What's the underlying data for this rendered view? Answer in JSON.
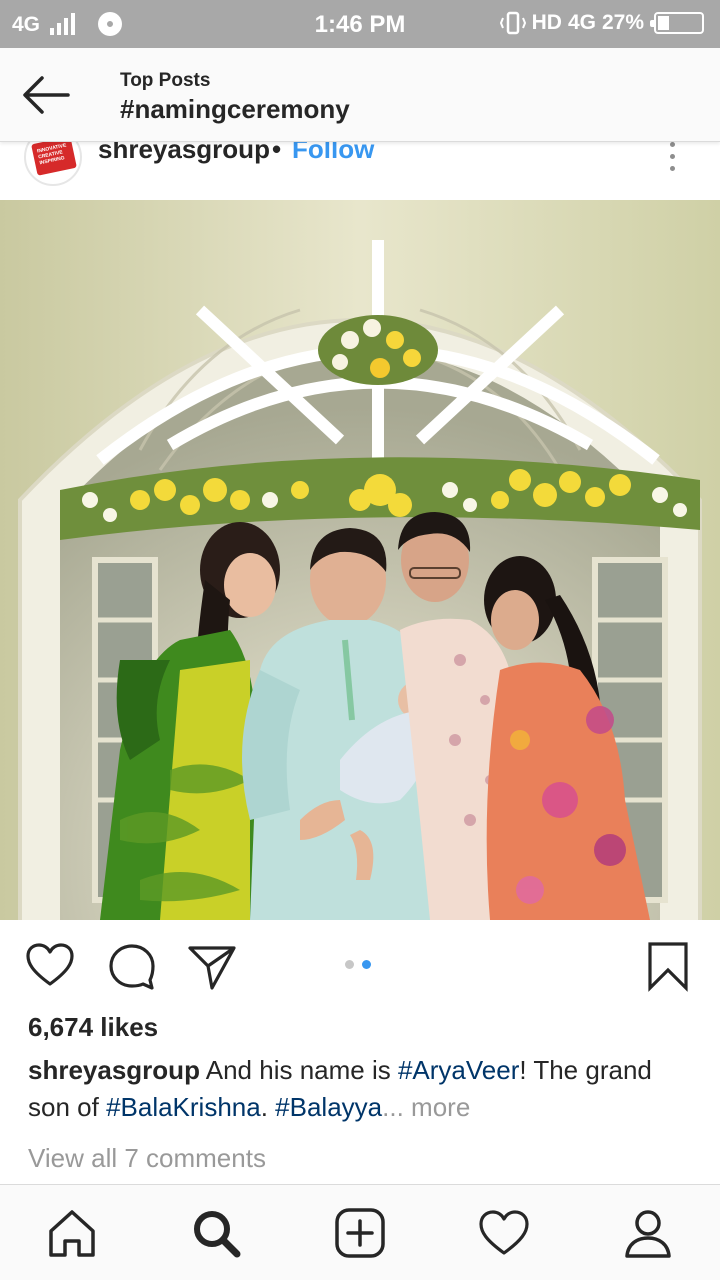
{
  "status_bar": {
    "network": "4G",
    "time": "1:46 PM",
    "hd_label": "HD",
    "network_right": "4G",
    "battery_percent": "27%",
    "battery_level": 0.27
  },
  "header": {
    "subtitle": "Top Posts",
    "title": "#namingceremony"
  },
  "post": {
    "username": "shreyasgroup",
    "separator": "•",
    "follow_label": "Follow",
    "avatar_logo_text": "INNOVATIVE CREATIVE INSPIRING",
    "likes": "6,674 likes",
    "caption": {
      "user": "shreyasgroup",
      "text1": " And his name is ",
      "tag1": "#AryaVeer",
      "text2": "! The grand son of ",
      "tag2": "#BalaKrishna",
      "text3": ". ",
      "tag3": "#Balayya",
      "ellipsis": "...",
      "more": " more"
    },
    "view_comments": "View all 7 comments",
    "carousel": {
      "count": 2,
      "active_index": 1
    }
  },
  "icons": {
    "back": "back-arrow-icon",
    "like": "heart-icon",
    "comment": "comment-bubble-icon",
    "share": "paper-plane-icon",
    "save": "bookmark-icon",
    "home": "home-icon",
    "search": "search-icon",
    "add": "plus-square-icon",
    "activity": "heart-outline-icon",
    "profile": "profile-icon"
  },
  "colors": {
    "accent": "#3897f0",
    "hashtag": "#003569",
    "status_bar": "#a8a8a8",
    "muted_text": "#999999"
  }
}
